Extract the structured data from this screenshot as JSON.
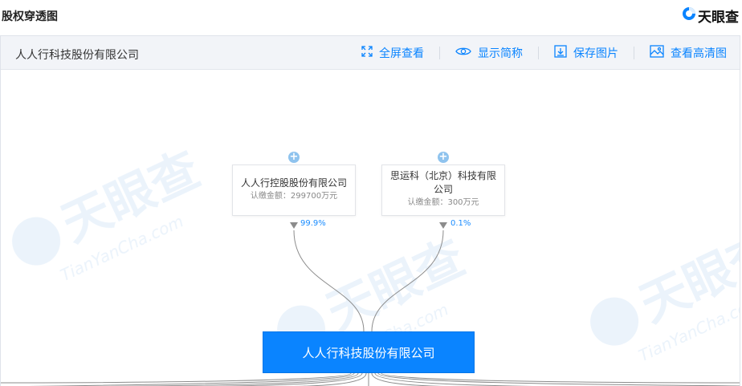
{
  "header": {
    "title": "股权穿透图",
    "brand": "天眼查"
  },
  "toolbar": {
    "company": "人人行科技股份有限公司",
    "actions": [
      {
        "label": "全屏查看",
        "icon": "fullscreen-icon"
      },
      {
        "label": "显示简称",
        "icon": "eye-icon"
      },
      {
        "label": "保存图片",
        "icon": "download-icon"
      },
      {
        "label": "查看高清图",
        "icon": "image-icon"
      }
    ]
  },
  "shareholders": [
    {
      "name": "人人行控股股份有限公司",
      "amount": "认缴金额：299700万元",
      "percent": "99.9%"
    },
    {
      "name_line1": "思运科（北京）科技有限",
      "name_line2": "公司",
      "amount": "认缴金额：300万元",
      "percent": "0.1%"
    }
  ],
  "main_company": "人人行科技股份有限公司",
  "colors": {
    "accent": "#0a84ff",
    "plus": "#8fc3ee",
    "edge": "#8c8c8c"
  }
}
